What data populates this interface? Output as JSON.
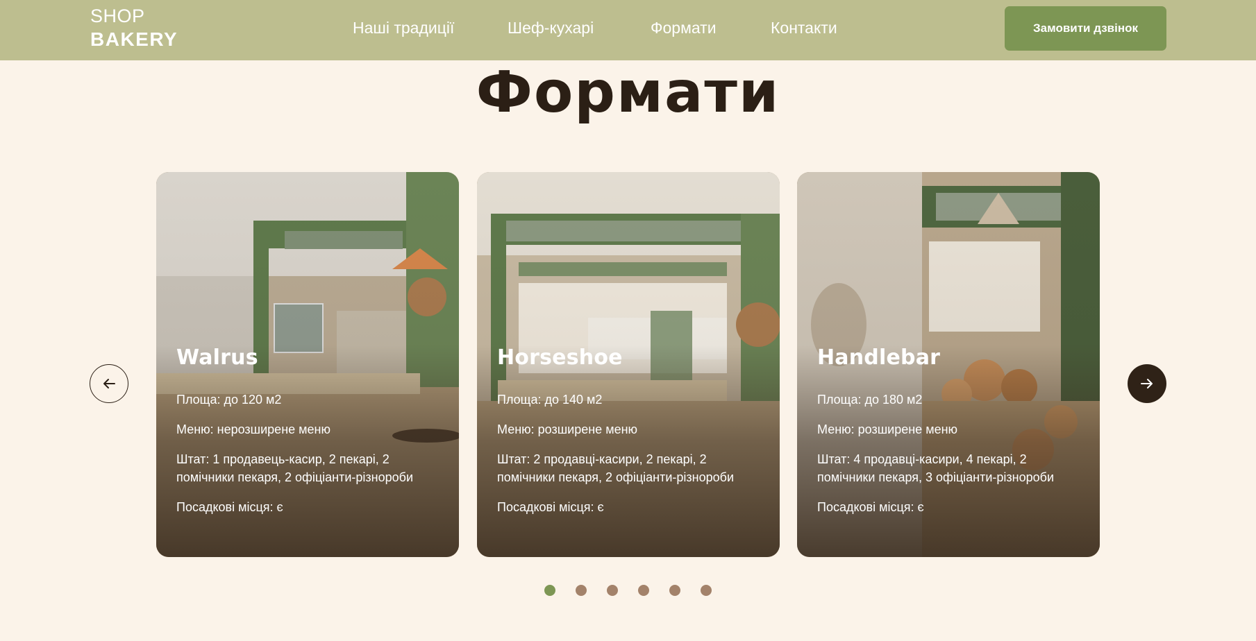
{
  "header": {
    "logo_top": "SHOP",
    "logo_bottom": "BAKERY",
    "nav": [
      "Наші традиції",
      "Шеф-кухарі",
      "Формати",
      "Контакти"
    ],
    "cta_label": "Замовити дзвінок"
  },
  "section": {
    "title": "Формати"
  },
  "cards": [
    {
      "title": "Walrus",
      "area": "Площа: до 120 м2",
      "menu": "Меню: нерозширене меню",
      "staff": "Штат: 1 продавець-касир, 2 пекарі, 2 помічники пекаря, 2 офіціанти-різнороби",
      "seats": "Посадкові місця: є"
    },
    {
      "title": "Horseshoe",
      "area": "Площа: до 140 м2",
      "menu": "Меню: розширене меню",
      "staff": "Штат: 2 продавці-касири, 2 пекарі, 2 помічники пекаря, 2 офіціанти-різнороби",
      "seats": "Посадкові місця: є"
    },
    {
      "title": "Handlebar",
      "area": "Площа: до 180 м2",
      "menu": "Меню: розширене меню",
      "staff": "Штат: 4 продавці-касири, 4 пекарі, 2 помічники пекаря, 3 офіціанти-різнороби",
      "seats": "Посадкові місця: є"
    }
  ],
  "carousel": {
    "prev_icon": "arrow-left-icon",
    "next_icon": "arrow-right-icon",
    "dot_count": 6,
    "active_dot": 1
  },
  "colors": {
    "header_bg": "#bdbe8f",
    "page_bg": "#fbf3e9",
    "accent_green": "#7d9654",
    "dark_brown": "#2b1f15",
    "dot_inactive": "#a3826a"
  }
}
